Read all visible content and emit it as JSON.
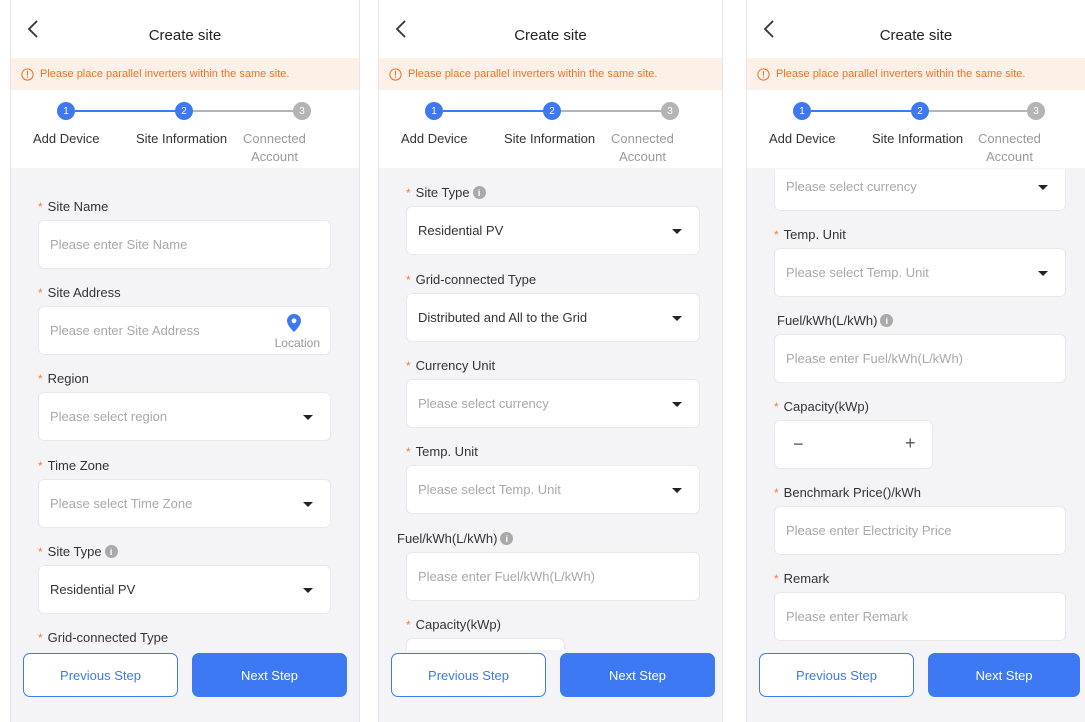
{
  "app": {
    "title": "Create site",
    "banner": "Please place parallel inverters within the same site.",
    "steps": [
      {
        "number": "1",
        "label": "Add Device"
      },
      {
        "number": "2",
        "label": "Site Information"
      },
      {
        "number": "3",
        "label_line1": "Connected",
        "label_line2": "Account"
      }
    ],
    "buttons": {
      "previous": "Previous Step",
      "next": "Next Step"
    },
    "colors": {
      "accent": "#3d79f2",
      "required": "#f08040",
      "banner_text": "#f0712a",
      "banner_bg": "#fdf1e7"
    },
    "icons": {
      "back": "chevron-left-icon",
      "info": "info-circle-icon",
      "help": "info-filled-icon",
      "location": "location-pin-icon",
      "dropdown": "caret-down-icon"
    }
  },
  "fields": {
    "site_name": {
      "label": "Site Name",
      "placeholder": "Please enter Site Name"
    },
    "site_address": {
      "label": "Site Address",
      "placeholder": "Please enter Site Address",
      "action": "Location"
    },
    "region": {
      "label": "Region",
      "placeholder": "Please select region"
    },
    "time_zone": {
      "label": "Time Zone",
      "placeholder": "Please select Time Zone"
    },
    "site_type": {
      "label": "Site Type",
      "value": "Residential PV"
    },
    "grid_type": {
      "label": "Grid-connected Type",
      "value": "Distributed and All to the Grid"
    },
    "currency": {
      "label": "Currency Unit",
      "placeholder": "Please select currency"
    },
    "temp_unit": {
      "label": "Temp. Unit",
      "placeholder": "Please select Temp. Unit"
    },
    "fuel": {
      "label": "Fuel/kWh(L/kWh)",
      "placeholder": "Please enter Fuel/kWh(L/kWh)"
    },
    "capacity": {
      "label": "Capacity(kWp)",
      "minus": "−",
      "plus": "+"
    },
    "benchmark": {
      "label": "Benchmark Price()/kWh",
      "placeholder": "Please enter Electricity Price"
    },
    "remark": {
      "label": "Remark",
      "placeholder": "Please enter Remark"
    }
  }
}
